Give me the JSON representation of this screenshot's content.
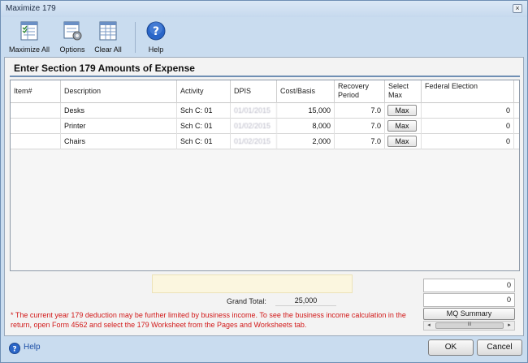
{
  "window": {
    "title": "Maximize 179",
    "close_glyph": "×"
  },
  "toolbar": {
    "items": [
      {
        "label": "Maximize All",
        "icon": "maximize-all-icon"
      },
      {
        "label": "Options",
        "icon": "options-icon"
      },
      {
        "label": "Clear All",
        "icon": "clear-all-icon"
      },
      {
        "label": "Help",
        "icon": "help-icon"
      }
    ]
  },
  "section": {
    "title": "Enter Section 179 Amounts of Expense"
  },
  "grid": {
    "columns": {
      "item": "Item#",
      "description": "Description",
      "activity": "Activity",
      "dpis": "DPIS",
      "cost": "Cost/Basis",
      "recovery_1": "Recovery",
      "recovery_2": "Period",
      "select_1": "Select",
      "select_2": "Max",
      "federal": "Federal Election"
    },
    "rows": [
      {
        "item": "",
        "description": "Desks",
        "activity": "Sch C: 01",
        "dpis": "01/01/2015",
        "cost": "15,000",
        "recovery": "7.0",
        "max_label": "Max",
        "federal": "0"
      },
      {
        "item": "",
        "description": "Printer",
        "activity": "Sch C: 01",
        "dpis": "01/02/2015",
        "cost": "8,000",
        "recovery": "7.0",
        "max_label": "Max",
        "federal": "0"
      },
      {
        "item": "",
        "description": "Chairs",
        "activity": "Sch C: 01",
        "dpis": "01/02/2015",
        "cost": "2,000",
        "recovery": "7.0",
        "max_label": "Max",
        "federal": "0"
      }
    ]
  },
  "totals": {
    "grand_total_label": "Grand Total:",
    "grand_total_value": "25,000",
    "side_value_1": "0",
    "side_value_2": "0",
    "mq_summary_label": "MQ Summary",
    "scroll_left": "◂",
    "scroll_right": "▸",
    "scroll_grip": "III"
  },
  "note": "* The current year 179 deduction may be further limited by business income. To see the business income calculation in the return, open Form 4562 and select the 179 Worksheet from the Pages and Worksheets tab.",
  "footer": {
    "help_label": "Help",
    "ok_label": "OK",
    "cancel_label": "Cancel"
  },
  "colors": {
    "note_text": "#d21a1a",
    "window_bg": "#c9dcef",
    "help_link": "#1d4fa6",
    "help_icon": "#2a66c8"
  }
}
